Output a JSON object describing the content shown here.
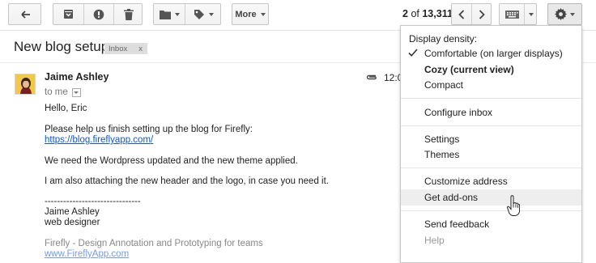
{
  "toolbar": {
    "more_label": "More",
    "pager_range": "2",
    "pager_of": "of",
    "pager_total": "13,311",
    "icons": [
      "back-arrow-icon",
      "archive-icon",
      "report-spam-icon",
      "delete-icon",
      "folder-icon",
      "label-tag-icon",
      "keyboard-icon",
      "gear-icon",
      "chevron-left-icon",
      "chevron-right-icon"
    ]
  },
  "message": {
    "subject": "New blog setup",
    "label": "Inbox",
    "label_remove": "x",
    "sender": "Jaime Ashley",
    "recipient": "to me",
    "time": "12:0",
    "greeting": "Hello, Eric",
    "para1": "Please help us finish setting up the blog for Firefly:",
    "link1": "https://blog.fireflyapp.com/",
    "para2": "We need the Wordpress updated and the new theme applied.",
    "para3": "I am also attaching the new header and the logo, in case you need it.",
    "sig_rule": "-------------------------------",
    "sig_name": "Jaime Ashley",
    "sig_title": "web designer",
    "footer_text": "Firefly - Design Annotation and Prototyping for teams",
    "footer_link": "www.FireflyApp.com"
  },
  "menu": {
    "density_header": "Display density:",
    "comfortable": "Comfortable (on larger displays)",
    "cozy": "Cozy (current view)",
    "compact": "Compact",
    "configure_inbox": "Configure inbox",
    "settings": "Settings",
    "themes": "Themes",
    "customize_address": "Customize address",
    "get_addons": "Get add-ons",
    "send_feedback": "Send feedback",
    "help": "Help"
  },
  "colors": {
    "link": "#1155cc",
    "menu_hover": "#eeeeee",
    "label_bg": "#dddddd"
  }
}
